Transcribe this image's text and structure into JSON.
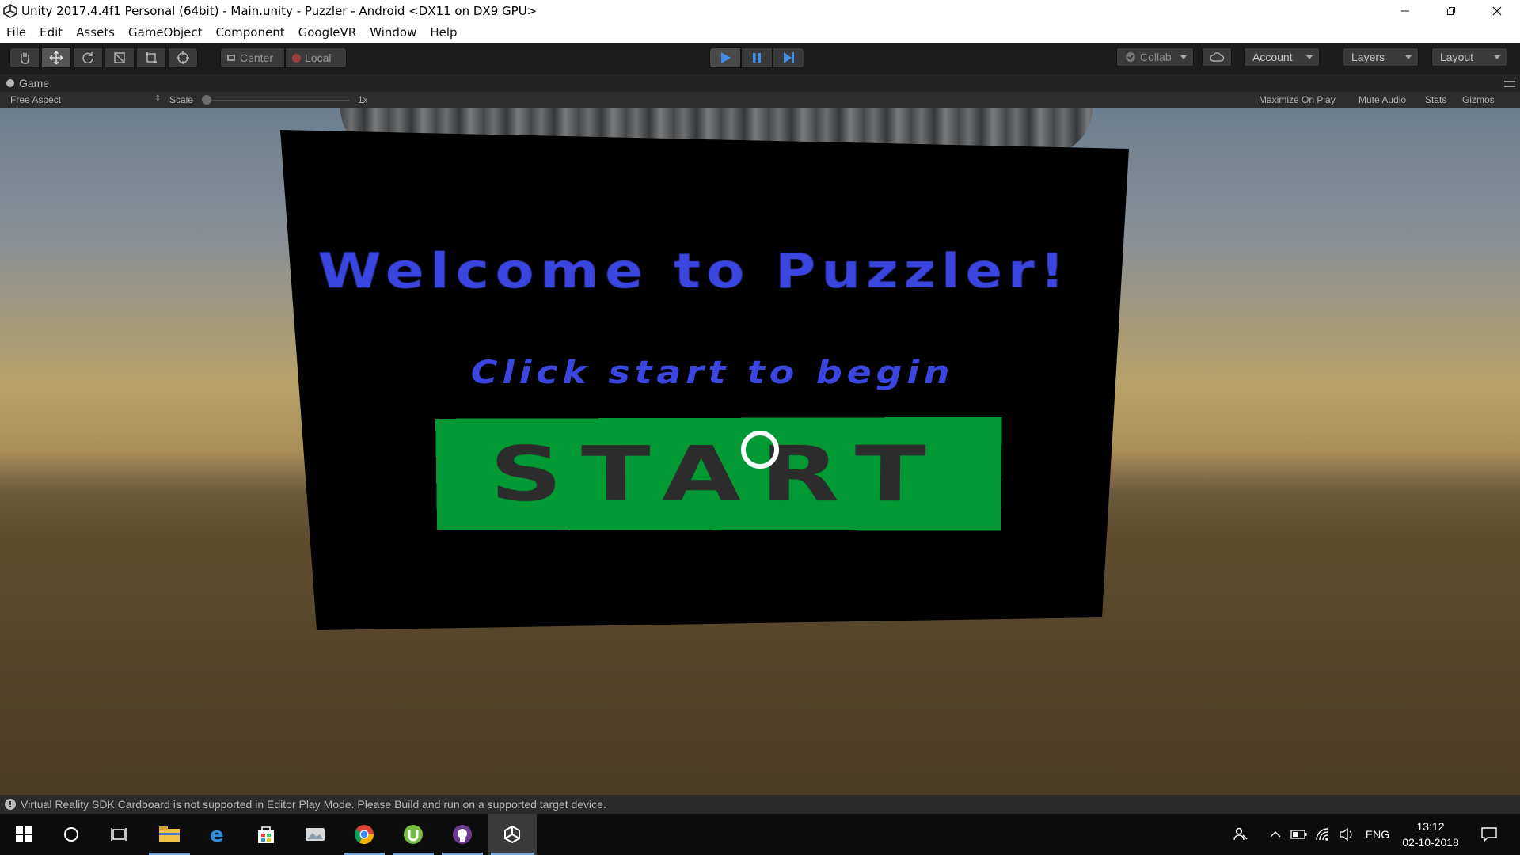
{
  "window": {
    "title": "Unity 2017.4.4f1 Personal (64bit) - Main.unity - Puzzler - Android <DX11 on DX9 GPU>"
  },
  "menubar": {
    "items": [
      "File",
      "Edit",
      "Assets",
      "GameObject",
      "Component",
      "GoogleVR",
      "Window",
      "Help"
    ]
  },
  "toolbar": {
    "pivot_center": "Center",
    "pivot_local": "Local",
    "collab": "Collab",
    "account": "Account",
    "layers": "Layers",
    "layout": "Layout"
  },
  "game_view": {
    "tab_label": "Game",
    "aspect": "Free Aspect",
    "scale_label": "Scale",
    "scale_value": "1x",
    "maximize_on_play": "Maximize On Play",
    "mute_audio": "Mute Audio",
    "stats": "Stats",
    "gizmos": "Gizmos"
  },
  "scene": {
    "welcome": "Welcome to Puzzler!",
    "subtitle": "Click start to begin",
    "start_button": "START",
    "colors": {
      "text_blue": "#3b46e0",
      "button_green": "#009933",
      "button_text": "#2c2c2c",
      "panel": "#000000"
    }
  },
  "status": {
    "message": "Virtual Reality SDK Cardboard is not supported in Editor Play Mode. Please Build and run on a supported target device."
  },
  "taskbar": {
    "apps": [
      "start-icon",
      "cortana-icon",
      "task-view-icon",
      "file-explorer-icon",
      "edge-icon",
      "store-icon",
      "photos-icon",
      "chrome-icon",
      "utorrent-icon",
      "github-icon",
      "unity-icon"
    ],
    "language": "ENG",
    "time": "13:12",
    "date": "02-10-2018"
  }
}
